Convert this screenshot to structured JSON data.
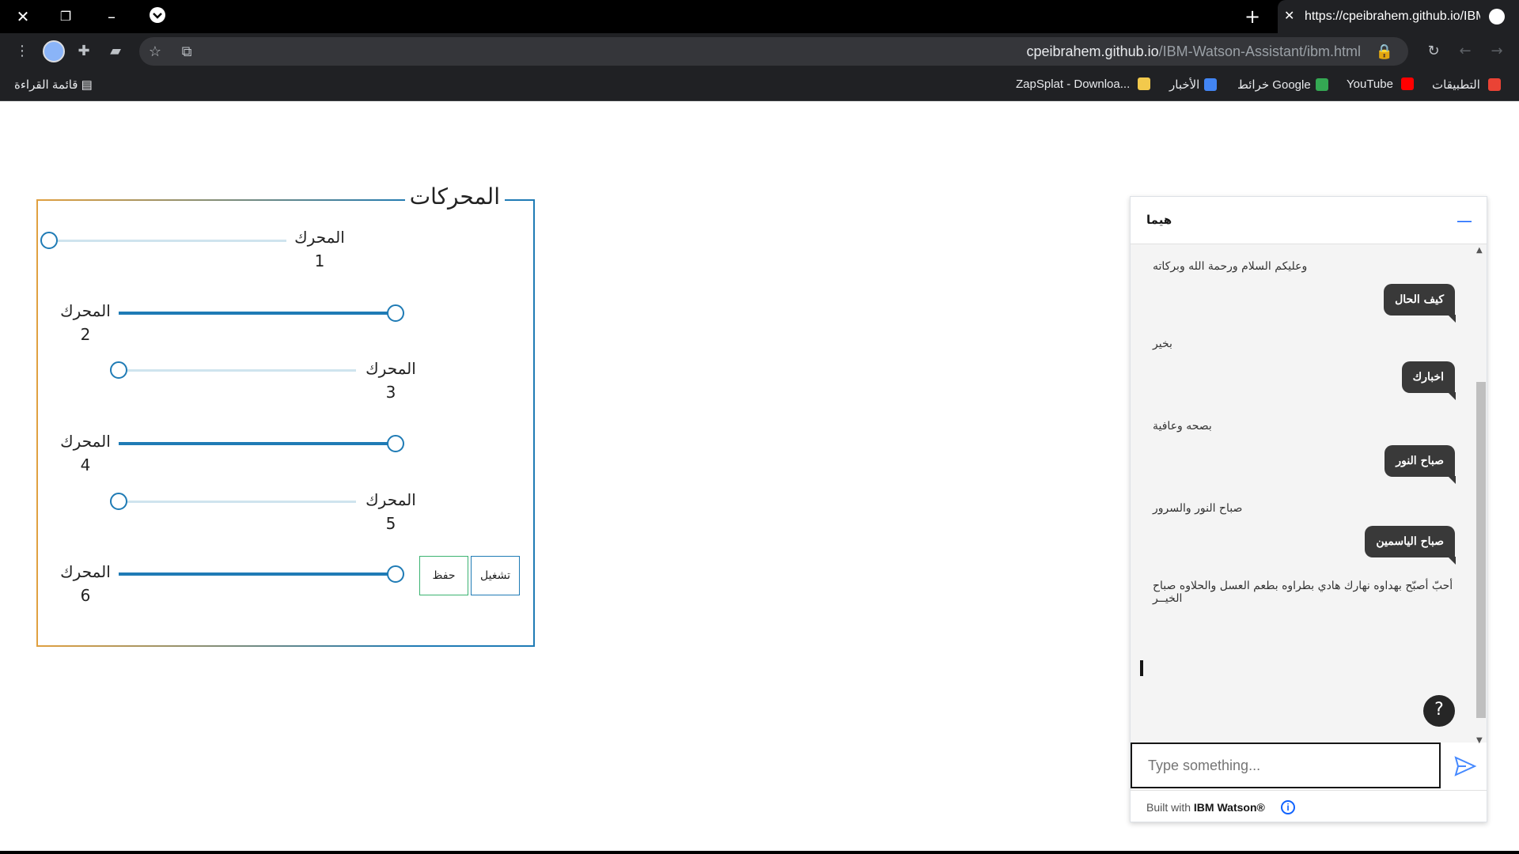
{
  "browser": {
    "tab_title": "https://cpeibrahem.github.io/IBM-Watson-Assistant/ibm.html",
    "url_host": "cpeibrahem.github.io",
    "url_path": "/IBM-Watson-Assistant/ibm.html",
    "bookmarks": {
      "apps": "التطبيقات",
      "youtube": "YouTube",
      "maps": "خرائط Google",
      "news": "الأخبار",
      "zapsplat": "ZapSplat - Downloa...",
      "reading_list": "قائمة القراءة"
    }
  },
  "motors": {
    "legend": "المحركات",
    "items": [
      {
        "label": "المحرك 1",
        "value": 0
      },
      {
        "label": "المحرك 2",
        "value": 100
      },
      {
        "label": "المحرك 3",
        "value": 0
      },
      {
        "label": "المحرك 4",
        "value": 100
      },
      {
        "label": "المحرك 5",
        "value": 0
      },
      {
        "label": "المحرك 6",
        "value": 100
      }
    ],
    "save_label": "حفظ",
    "run_label": "تشغيل"
  },
  "chat": {
    "title": "هيما",
    "messages": [
      {
        "from": "bot",
        "text": "وعليكم السلام ورحمة الله وبركاته"
      },
      {
        "from": "user",
        "text": "كيف الحال"
      },
      {
        "from": "bot",
        "text": "بخير"
      },
      {
        "from": "user",
        "text": "اخبارك"
      },
      {
        "from": "bot",
        "text": "بصحه وعافية"
      },
      {
        "from": "user",
        "text": "صباح النور"
      },
      {
        "from": "bot",
        "text": "صباح النور والسرور"
      },
      {
        "from": "user",
        "text": "صباح الياسمين"
      },
      {
        "from": "bot",
        "text": "أحبّ أصبّح بهداوه نهارك هادي بطراوه بطعم العسل والحلاوه صباح الخيــر"
      }
    ],
    "help_label": "?",
    "input_placeholder": "Type something...",
    "footer_prefix": "Built with",
    "footer_brand": "IBM Watson®"
  }
}
